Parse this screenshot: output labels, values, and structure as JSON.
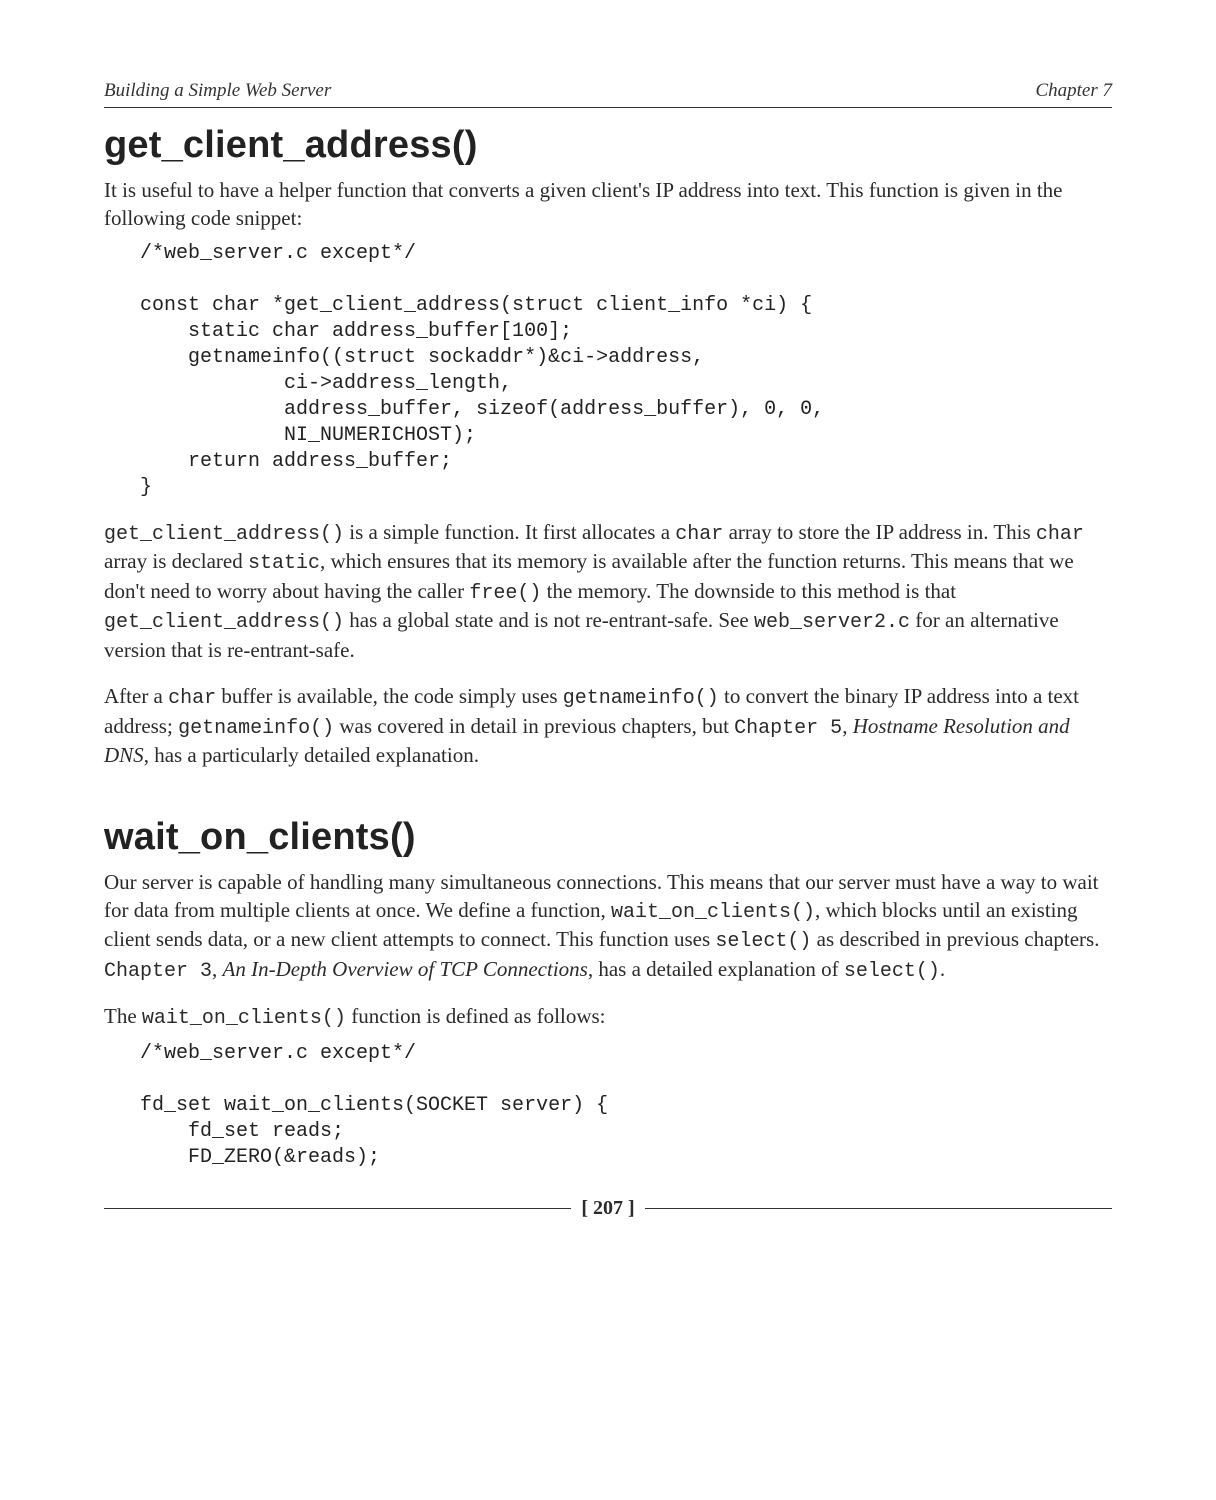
{
  "header": {
    "left": "Building a Simple Web Server",
    "right": "Chapter 7"
  },
  "section1": {
    "heading": "get_client_address()",
    "intro": "It is useful to have a helper function that converts a given client's IP address into text. This function is given in the following code snippet:",
    "code": "/*web_server.c except*/\n\nconst char *get_client_address(struct client_info *ci) {\n    static char address_buffer[100];\n    getnameinfo((struct sockaddr*)&ci->address,\n            ci->address_length,\n            address_buffer, sizeof(address_buffer), 0, 0,\n            NI_NUMERICHOST);\n    return address_buffer;\n}",
    "p1": {
      "t1": "get_client_address()",
      "t2": " is a simple function. It first allocates a ",
      "t3": "char",
      "t4": " array to store the IP address in. This ",
      "t5": "char",
      "t6": " array is declared ",
      "t7": "static",
      "t8": ", which ensures that its memory is available after the function returns. This means that we don't need to worry about having the caller ",
      "t9": "free()",
      "t10": " the memory. The downside to this method is that ",
      "t11": "get_client_address()",
      "t12": " has a global state and is not re-entrant-safe. See ",
      "t13": "web_server2.c",
      "t14": " for an alternative version that is re-entrant-safe."
    },
    "p2": {
      "t1": "After a ",
      "t2": "char",
      "t3": " buffer is available, the code simply uses ",
      "t4": "getnameinfo()",
      "t5": " to convert the binary IP address into a text address; ",
      "t6": "getnameinfo()",
      "t7": " was covered in detail in previous chapters, but ",
      "t8": "Chapter 5",
      "t9": ", ",
      "t10": "Hostname Resolution and DNS",
      "t11": ", has a particularly detailed explanation."
    }
  },
  "section2": {
    "heading": "wait_on_clients()",
    "p1": {
      "t1": "Our server is capable of handling many simultaneous connections. This means that our server must have a way to wait for data from multiple clients at once. We define a function, ",
      "t2": "wait_on_clients()",
      "t3": ", which blocks until an existing client sends data, or a new client attempts to connect. This function uses ",
      "t4": "select()",
      "t5": " as described in previous chapters. ",
      "t6": "Chapter 3",
      "t7": ", ",
      "t8": "An In-Depth Overview of TCP Connections",
      "t9": ", has a detailed explanation of ",
      "t10": "select()",
      "t11": "."
    },
    "p2": {
      "t1": "The ",
      "t2": "wait_on_clients()",
      "t3": " function is defined as follows:"
    },
    "code": "/*web_server.c except*/\n\nfd_set wait_on_clients(SOCKET server) {\n    fd_set reads;\n    FD_ZERO(&reads);"
  },
  "footer": {
    "page": "[ 207 ]"
  }
}
